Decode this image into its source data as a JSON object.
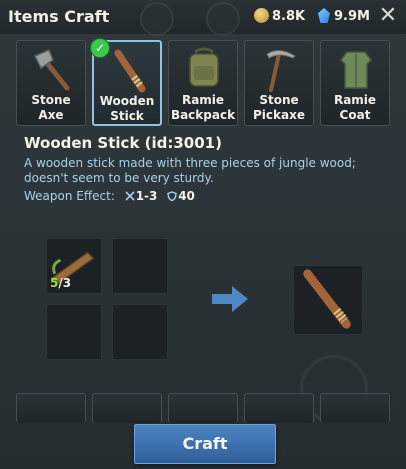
{
  "window": {
    "title": "Items Craft"
  },
  "currency": {
    "coins": "8.8K",
    "gems": "9.9M"
  },
  "tabs": [
    {
      "label": "Stone Axe",
      "icon": "stone-axe-icon"
    },
    {
      "label": "Wooden Stick",
      "icon": "wooden-stick-icon",
      "selected": true
    },
    {
      "label": "Ramie Backpack",
      "icon": "ramie-backpack-icon"
    },
    {
      "label": "Stone Pickaxe",
      "icon": "stone-pickaxe-icon"
    },
    {
      "label": "Ramie Coat",
      "icon": "ramie-coat-icon"
    }
  ],
  "item": {
    "name": "Wooden Stick (id:3001)",
    "description": "A wooden stick made with three pieces of jungle wood; doesn't seem to be very sturdy.",
    "effect_label": "Weapon Effect:",
    "attack": "1-3",
    "defense": "40"
  },
  "recipe": {
    "ingredient_have": "5",
    "ingredient_need": "/3"
  },
  "actions": {
    "craft": "Craft"
  },
  "colors": {
    "accent_blue": "#4b84c2",
    "desc_text": "#a9d1e8",
    "have_green": "#9be34e"
  }
}
